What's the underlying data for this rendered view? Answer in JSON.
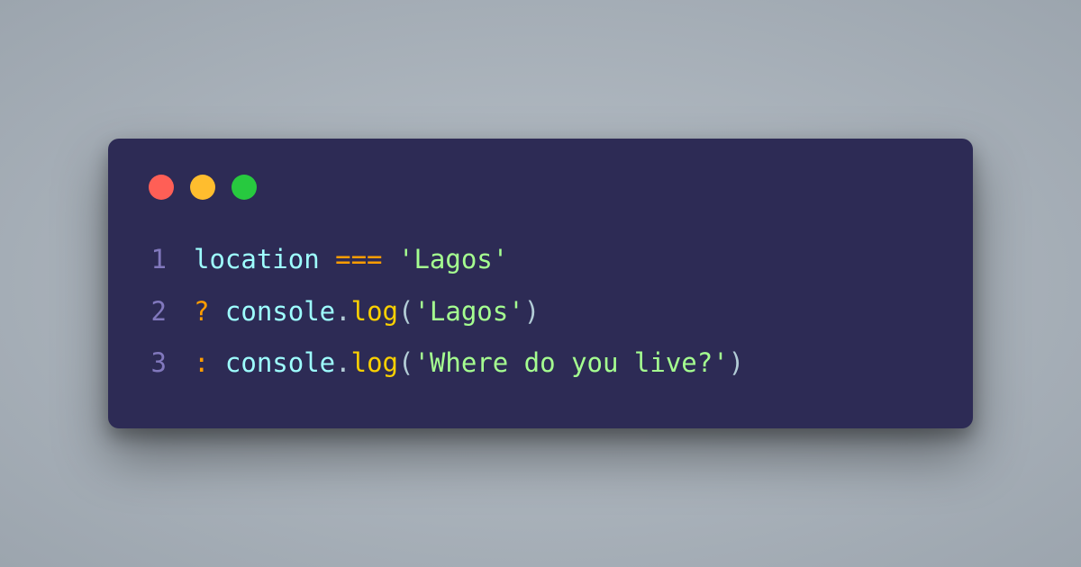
{
  "window": {
    "traffic_lights": {
      "red": "#ff5f56",
      "yellow": "#ffbd2e",
      "green": "#27c93f"
    }
  },
  "code": {
    "lines": [
      {
        "number": "1",
        "tokens": [
          {
            "text": "location ",
            "class": "tok-ident"
          },
          {
            "text": "===",
            "class": "tok-operator"
          },
          {
            "text": " ",
            "class": "tok-default"
          },
          {
            "text": "'Lagos'",
            "class": "tok-string"
          }
        ]
      },
      {
        "number": "2",
        "tokens": [
          {
            "text": "? ",
            "class": "tok-operator"
          },
          {
            "text": "console",
            "class": "tok-ident"
          },
          {
            "text": ".",
            "class": "tok-punct"
          },
          {
            "text": "log",
            "class": "tok-method"
          },
          {
            "text": "(",
            "class": "tok-punct"
          },
          {
            "text": "'Lagos'",
            "class": "tok-string"
          },
          {
            "text": ")",
            "class": "tok-punct"
          }
        ]
      },
      {
        "number": "3",
        "tokens": [
          {
            "text": ": ",
            "class": "tok-operator"
          },
          {
            "text": "console",
            "class": "tok-ident"
          },
          {
            "text": ".",
            "class": "tok-punct"
          },
          {
            "text": "log",
            "class": "tok-method"
          },
          {
            "text": "(",
            "class": "tok-punct"
          },
          {
            "text": "'Where do you live?'",
            "class": "tok-string"
          },
          {
            "text": ")",
            "class": "tok-punct"
          }
        ]
      }
    ]
  }
}
